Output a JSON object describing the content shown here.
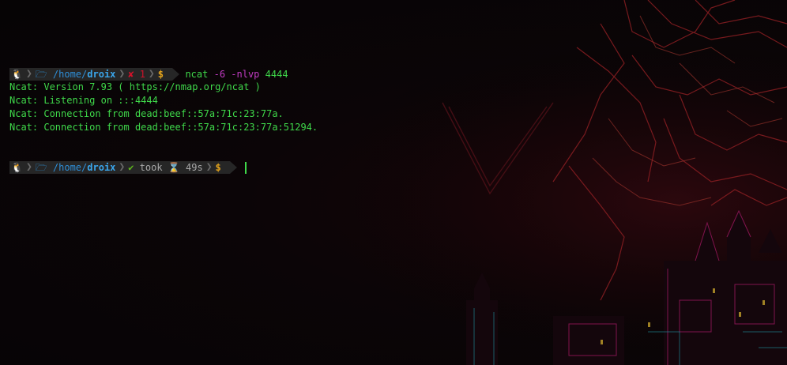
{
  "prompt1": {
    "os_icon": "🐧",
    "folder_icon": "🗁",
    "path_prefix": "/home/",
    "path_dir": "droix",
    "status_icon": "✘",
    "exit_code": "1",
    "dollar": "$"
  },
  "command": {
    "program": "ncat",
    "flag1": "-6",
    "flag2": "-nlvp",
    "port": "4444"
  },
  "output": [
    "Ncat: Version 7.93 ( https://nmap.org/ncat )",
    "Ncat: Listening on :::4444",
    "Ncat: Connection from dead:beef::57a:71c:23:77a.",
    "Ncat: Connection from dead:beef::57a:71c:23:77a:51294."
  ],
  "prompt2": {
    "os_icon": "🐧",
    "folder_icon": "🗁",
    "path_prefix": "/home/",
    "path_dir": "droix",
    "status_icon": "✔",
    "took_label": "took",
    "hourglass_icon": "⌛",
    "duration": "49s",
    "dollar": "$"
  },
  "colors": {
    "segment_bg": "#262626",
    "path": "#2e8fd8",
    "error": "#d1122a",
    "success": "#5fb81c",
    "dollar": "#e6a51c",
    "output_text": "#3fd84a",
    "command_flag": "#c23bc4"
  }
}
